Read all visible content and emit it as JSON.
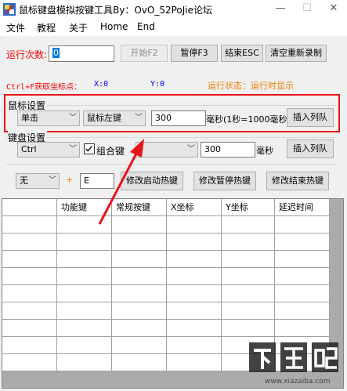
{
  "window": {
    "title": "鼠标键盘模拟按键工具By：OvO_52PoJie论坛",
    "minimize_glyph": "—",
    "maximize_glyph": "☐",
    "close_glyph": "✕"
  },
  "menu": {
    "items": [
      "文件",
      "教程",
      "关于",
      "Home",
      "End"
    ]
  },
  "run": {
    "count_label": "运行次数:",
    "count_value": "0",
    "start_button": "开始F2",
    "pause_button": "暂停F3",
    "stop_button": "结束ESC",
    "clear_button": "清空重新录制"
  },
  "status": {
    "coord_hint": "Ctrl+F获取坐标点：",
    "x_label": "X:0",
    "y_label": "Y:0",
    "run_state": "运行状态：运行时显示"
  },
  "mouse": {
    "section_title": "鼠标设置",
    "action_selected": "单击",
    "button_selected": "鼠标左键",
    "delay_value": "300",
    "delay_unit": "毫秒(1秒=1000毫秒",
    "insert_button": "插入列队"
  },
  "keyboard": {
    "section_title": "键盘设置",
    "modifier_selected": "Ctrl",
    "combo_label": "组合键",
    "combo_checked": true,
    "key_selected": "",
    "delay_value": "300",
    "delay_unit": "毫秒",
    "insert_button": "插入列队"
  },
  "hotkey": {
    "modifier_selected": "无",
    "plus_sign": "+",
    "key_value": "E",
    "start_hotkey_button": "修改启动热键",
    "pause_hotkey_button": "修改暂停热键",
    "stop_hotkey_button": "修改结束热键"
  },
  "table": {
    "columns": [
      "",
      "功能键",
      "常规按键",
      "X坐标",
      "Y坐标",
      "延迟时间"
    ],
    "row_count_visible": 9
  },
  "watermark": {
    "logo_text": "下载吧",
    "url_text": "www.xiazaiba.com"
  },
  "colors": {
    "highlight_box": "#e8141a",
    "arrow": "#e8141a",
    "run_count_label": "#ff0000",
    "status_orange": "#e87b00",
    "coord_blue": "#0000ff"
  }
}
